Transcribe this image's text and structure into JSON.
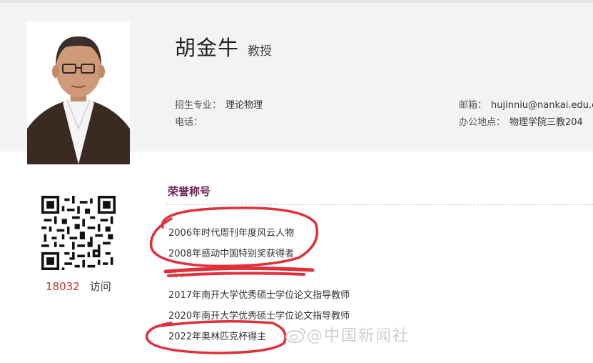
{
  "profile": {
    "name": "胡金牛",
    "title": "教授",
    "major_label": "招生专业：",
    "major_value": "理论物理",
    "phone_label": "电话：",
    "phone_value": "",
    "email_label": "邮箱：",
    "email_value": "hujinniu@nankai.edu.cn",
    "office_label": "办公地点：",
    "office_value": "物理学院三教204"
  },
  "stats": {
    "visit_count": "18032",
    "visit_label": "访问"
  },
  "honors": {
    "section_title": "荣誉称号",
    "items": [
      "2006年时代周刊年度风云人物",
      "2008年感动中国特别奖获得者",
      "（ ）",
      "2017年南开大学优秀硕士学位论文指导教师",
      "2020年南开大学优秀硕士学位论文指导教师",
      "2022年奥林匹克杯得主"
    ]
  },
  "watermark": {
    "text": "@中国新闻社"
  },
  "colors": {
    "accent": "#6b1d52",
    "visit_count": "#c0392b",
    "annotation_red": "#e0303a",
    "header_band": "#f3f3f3"
  }
}
